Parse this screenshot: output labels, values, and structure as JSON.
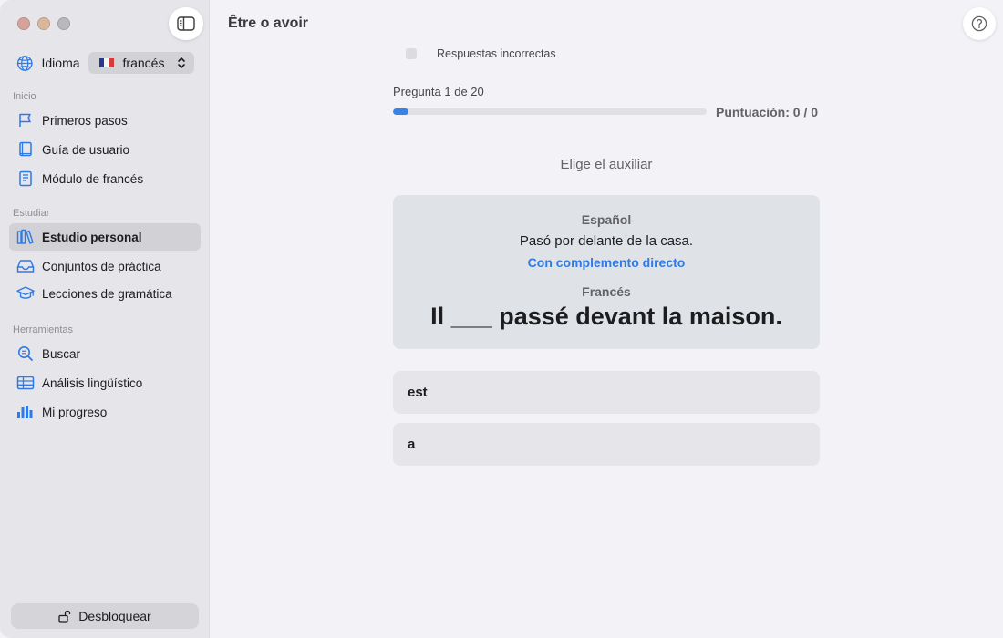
{
  "window": {
    "title": "Être o avoir"
  },
  "sidebar": {
    "language_label": "Idioma",
    "language_value": "francés",
    "sections": [
      {
        "title": "Inicio",
        "items": [
          {
            "label": "Primeros pasos",
            "icon": "flag-icon"
          },
          {
            "label": "Guía de usuario",
            "icon": "book-icon"
          },
          {
            "label": "Módulo de francés",
            "icon": "document-book-icon"
          }
        ]
      },
      {
        "title": "Estudiar",
        "items": [
          {
            "label": "Estudio personal",
            "icon": "books-icon",
            "active": true
          },
          {
            "label": "Conjuntos de práctica",
            "icon": "tray-icon"
          },
          {
            "label": "Lecciones de gramática",
            "icon": "graduation-cap-icon"
          }
        ]
      },
      {
        "title": "Herramientas",
        "items": [
          {
            "label": "Buscar",
            "icon": "search-document-icon"
          },
          {
            "label": "Análisis lingüístico",
            "icon": "table-icon"
          },
          {
            "label": "Mi progreso",
            "icon": "bar-chart-icon"
          }
        ]
      }
    ],
    "unlock_label": "Desbloquear"
  },
  "quiz": {
    "filter_label": "Respuestas incorrectas",
    "question_counter": "Pregunta 1 de 20",
    "progress_fraction": 0.05,
    "score_text": "Puntuación: 0 / 0",
    "instruction": "Elige el auxiliar",
    "card": {
      "source_language": "Español",
      "source_sentence": "Pasó por delante de la casa.",
      "hint": "Con complemento directo",
      "target_language": "Francés",
      "target_sentence": "Il ___ passé devant la maison."
    },
    "options": [
      "est",
      "a"
    ]
  },
  "colors": {
    "accent": "#3b82e5",
    "link": "#2f7ae5",
    "sidebar_bg": "#e5e5ea",
    "main_bg": "#f2f2f7",
    "card_bg": "#dfe3e7"
  }
}
